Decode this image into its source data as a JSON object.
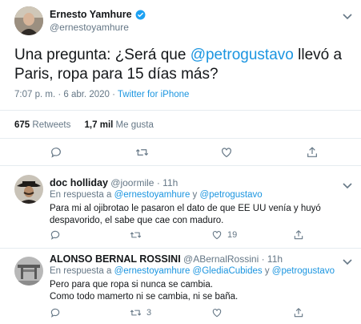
{
  "main_tweet": {
    "author_name": "Ernesto Yamhure",
    "author_handle": "@ernestoyamhure",
    "text_prefix": "Una pregunta: ¿Será que ",
    "text_mention": "@petrogustavo",
    "text_suffix": " llevó a Paris, ropa para 15 días más?",
    "time": "7:07 p. m. · 6 abr. 2020 · ",
    "source": "Twitter for iPhone",
    "retweets_count": "675",
    "retweets_label": "Retweets",
    "likes_count": "1,7 mil",
    "likes_label": "Me gusta"
  },
  "replies": [
    {
      "author_name": "doc holliday",
      "author_handle": "@joormile",
      "time": "· 11h",
      "reply_prefix": "En respuesta a ",
      "reply_to_1": "@ernestoyamhure",
      "reply_join": " y ",
      "reply_to_2": "@petrogustavo",
      "text_line1": "Para mi al ojibrotao le pasaron el dato de que  EE UU venía y huyó",
      "text_line2": "despavorido, el sabe que cae con maduro.",
      "retweets": "",
      "likes": "19"
    },
    {
      "author_name": "ALONSO BERNAL ROSSINI",
      "author_handle": "@ABernalRossini",
      "time": "· 11h",
      "reply_prefix": "En respuesta a ",
      "reply_to_1": "@ernestoyamhure",
      "reply_to_2": "@GlediaCubides",
      "reply_join": " y ",
      "reply_to_3": "@petrogustavo",
      "text_line1": "Pero para que ropa si nunca se cambia.",
      "text_line2": "Como todo mamerto ni se cambia, ni se baña.",
      "retweets": "3",
      "likes": ""
    }
  ],
  "icons": {
    "verified": "verified-badge-icon",
    "caret": "chevron-down-icon",
    "reply": "reply-icon",
    "retweet": "retweet-icon",
    "like": "heart-icon",
    "share": "share-icon"
  },
  "colors": {
    "link": "#1b95e0",
    "muted": "#657786",
    "divider": "#e6ecf0",
    "verified": "#1da1f2"
  }
}
